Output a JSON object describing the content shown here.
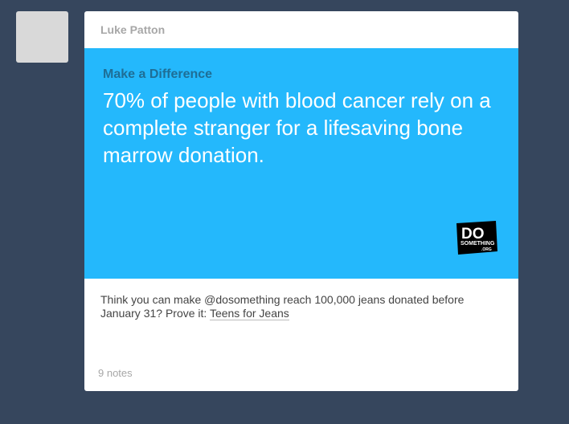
{
  "post": {
    "author": "Luke Patton",
    "banner": {
      "kicker": "Make a Difference",
      "headline": "70% of people with blood cancer rely on a complete stranger for a lifesaving bone marrow donation.",
      "logo_lines": [
        "DO",
        "SOMETHING",
        ".ORG"
      ],
      "background_color": "#24b8fc"
    },
    "caption": {
      "text": "Think you can make @dosomething reach 100,000 jeans donated before January 31? Prove it: ",
      "link_label": "Teens for Jeans"
    },
    "notes": "9 notes"
  }
}
